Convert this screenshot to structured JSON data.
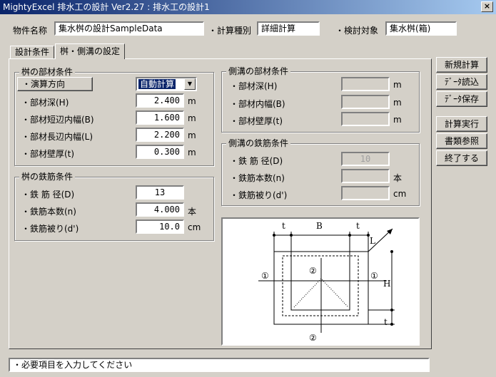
{
  "window": {
    "title": "MightyExcel 排水工の設計 Ver2.27 : 排水工の設計1",
    "close_label": "×"
  },
  "header": {
    "property_label": "物件名称",
    "property_value": "集水桝の設計SampleData",
    "calc_type_label": "・計算種別",
    "calc_type_value": "詳細計算",
    "target_label": "・検討対象",
    "target_value": "集水桝(箱)"
  },
  "tabs": [
    {
      "label": "設計条件"
    },
    {
      "label": "桝・側溝の設定"
    }
  ],
  "masu_members": {
    "title": "桝の部材条件",
    "calc_direction_label": "・演算方向",
    "calc_direction_value": "自動計算",
    "rows": [
      {
        "label": "・部材深(H)",
        "value": "2.400",
        "unit": "m"
      },
      {
        "label": "・部材短辺内幅(B)",
        "value": "1.600",
        "unit": "m"
      },
      {
        "label": "・部材長辺内幅(L)",
        "value": "2.200",
        "unit": "m"
      },
      {
        "label": "・部材壁厚(t)",
        "value": "0.300",
        "unit": "m"
      }
    ]
  },
  "masu_rebar": {
    "title": "桝の鉄筋条件",
    "rows": [
      {
        "label": "・鉄 筋 径(D)",
        "value": "13",
        "unit": ""
      },
      {
        "label": "・鉄筋本数(n)",
        "value": "4.000",
        "unit": "本"
      },
      {
        "label": "・鉄筋被り(d')",
        "value": "10.0",
        "unit": "cm"
      }
    ]
  },
  "gutter_members": {
    "title": "側溝の部材条件",
    "rows": [
      {
        "label": "・部材深(H)",
        "value": "",
        "unit": "m"
      },
      {
        "label": "・部材内幅(B)",
        "value": "",
        "unit": "m"
      },
      {
        "label": "・部材壁厚(t)",
        "value": "",
        "unit": "m"
      }
    ]
  },
  "gutter_rebar": {
    "title": "側溝の鉄筋条件",
    "rows": [
      {
        "label": "・鉄 筋 径(D)",
        "value": "10",
        "unit": ""
      },
      {
        "label": "・鉄筋本数(n)",
        "value": "",
        "unit": "本"
      },
      {
        "label": "・鉄筋被り(d')",
        "value": "",
        "unit": "cm"
      }
    ]
  },
  "buttons": {
    "new_calc": "新規計算",
    "data_load": "ﾃﾞｰﾀ読込",
    "data_save": "ﾃﾞｰﾀ保存",
    "run_calc": "計算実行",
    "doc_ref": "書類参照",
    "exit": "終了する"
  },
  "diagram": {
    "label_t_left": "t",
    "label_b": "B",
    "label_t_right": "t",
    "label_l": "L",
    "label_h": "H",
    "label_t_bottom": "t",
    "label_1_left": "①",
    "label_1_right": "①",
    "label_2_top": "②",
    "label_2_bottom": "②"
  },
  "status": {
    "message": "・必要項目を入力してください"
  }
}
